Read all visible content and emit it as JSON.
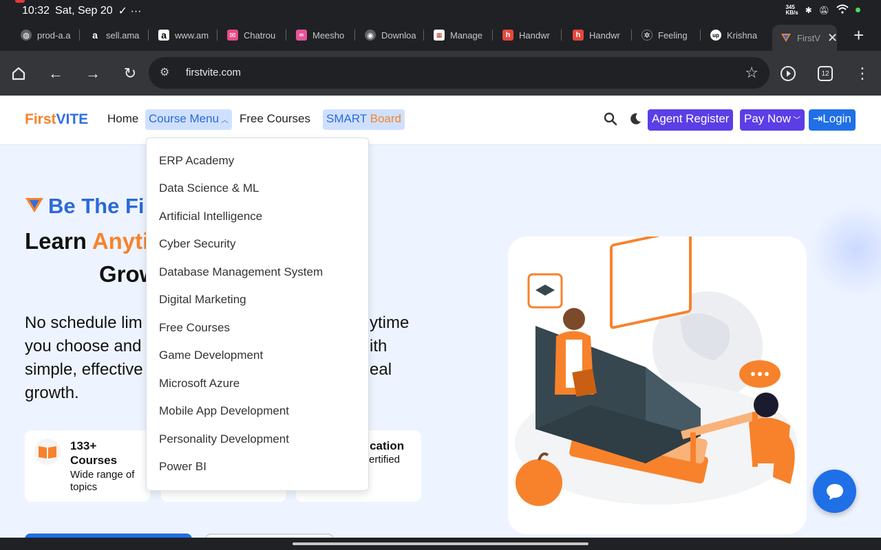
{
  "status_bar": {
    "time": "10:32",
    "date": "Sat, Sep 20",
    "extra": "✓ ···",
    "net_speed_top": "345",
    "net_speed_bottom": "KB/s"
  },
  "tabs": [
    {
      "label": "prod-a.a",
      "icon": "globe-icon",
      "color": "#5f6368"
    },
    {
      "label": "sell.ama",
      "icon": "amazon-icon",
      "color": "#202124"
    },
    {
      "label": "www.am",
      "icon": "amazon-icon",
      "color": "#ffffff"
    },
    {
      "label": "Chatrou",
      "icon": "chatrou-icon",
      "color": "#e94c89"
    },
    {
      "label": "Meesho",
      "icon": "meesho-icon",
      "color": "#e4569b"
    },
    {
      "label": "Downloa",
      "icon": "chrome-icon",
      "color": "#5f6368"
    },
    {
      "label": "Manage",
      "icon": "manage-icon",
      "color": "#ffffff"
    },
    {
      "label": "Handwr",
      "icon": "handwr-icon",
      "color": "#e5483d"
    },
    {
      "label": "Handwr",
      "icon": "handwr-icon",
      "color": "#e5483d"
    },
    {
      "label": "Feeling",
      "icon": "openai-icon",
      "color": "#202124"
    },
    {
      "label": "Krishna",
      "icon": "upwork-icon",
      "color": "#202124"
    },
    {
      "label": "FirstV",
      "icon": "firstvite-icon",
      "color": "#35363a",
      "active": true
    }
  ],
  "toolbar": {
    "url": "firstvite.com",
    "tab_count": "12"
  },
  "nav": {
    "brand_first": "First",
    "brand_second": "VITE",
    "home": "Home",
    "course_menu": "Course Menu",
    "free_courses": "Free Courses",
    "smart": "SMART",
    "board": "Board",
    "agent_register": "Agent Register",
    "pay_now": "Pay Now",
    "login": "Login"
  },
  "dropdown": {
    "items": [
      "ERP Academy",
      "Data Science & ML",
      "Artificial Intelligence",
      "Cyber Security",
      "Database Management System",
      "Digital Marketing",
      "Free Courses",
      "Game Development",
      "Microsoft Azure",
      "Mobile App Development",
      "Personality Development",
      "Power BI"
    ]
  },
  "hero": {
    "line1": "Be The Fi",
    "line2_a": "Learn ",
    "line2_b": "Anyti",
    "line3": "Grow",
    "paragraph_l1": "No schedule lim",
    "paragraph_l1b": "ytime",
    "paragraph_l2": "you choose and",
    "paragraph_l2b": "ith",
    "paragraph_l3": "simple, effective",
    "paragraph_l3b": "eal",
    "paragraph_l4": "growth."
  },
  "cards": [
    {
      "title": "133+",
      "title2": "Courses",
      "sub": "Wide range of",
      "sub2": "topics"
    },
    {
      "title": "ification",
      "sub": "ertified"
    }
  ],
  "colors": {
    "accent_blue": "#1f6fe6",
    "accent_orange": "#f7822b",
    "accent_purple": "#5b3ee6"
  }
}
